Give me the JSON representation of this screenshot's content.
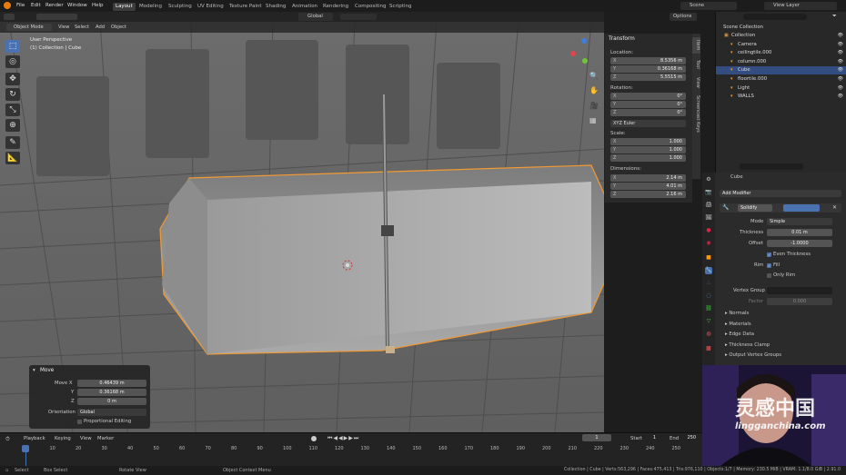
{
  "menu": [
    "File",
    "Edit",
    "Render",
    "Window",
    "Help"
  ],
  "workspaces": [
    "Layout",
    "Modeling",
    "Sculpting",
    "UV Editing",
    "Texture Paint",
    "Shading",
    "Animation",
    "Rendering",
    "Compositing",
    "Scripting"
  ],
  "scene_label": "Scene",
  "view_layer_label": "View Layer",
  "header": {
    "mode": "Object Mode",
    "view": "View",
    "select": "Select",
    "add": "Add",
    "object": "Object",
    "orientation": "Global",
    "options": "Options"
  },
  "viewport": {
    "perspective": "User Perspective",
    "collection_info": "(1) Collection | Cube"
  },
  "transform": {
    "title": "Transform",
    "location_label": "Location:",
    "location": [
      {
        "axis": "X",
        "value": "8.5356 m"
      },
      {
        "axis": "Y",
        "value": "0.36168 m"
      },
      {
        "axis": "Z",
        "value": "5.5515 m"
      }
    ],
    "rotation_label": "Rotation:",
    "rotation": [
      {
        "axis": "X",
        "value": "0°"
      },
      {
        "axis": "Y",
        "value": "0°"
      },
      {
        "axis": "Z",
        "value": "0°"
      }
    ],
    "rotation_mode": "XYZ Euler",
    "scale_label": "Scale:",
    "scale": [
      {
        "axis": "X",
        "value": "1.000"
      },
      {
        "axis": "Y",
        "value": "1.000"
      },
      {
        "axis": "Z",
        "value": "1.000"
      }
    ],
    "dimensions_label": "Dimensions:",
    "dimensions": [
      {
        "axis": "X",
        "value": "2.14 m"
      },
      {
        "axis": "Y",
        "value": "4.01 m"
      },
      {
        "axis": "Z",
        "value": "2.16 m"
      }
    ]
  },
  "ntabs": [
    "Item",
    "Tool",
    "View",
    "Screencast Keys"
  ],
  "outliner": {
    "root": "Scene Collection",
    "items": [
      {
        "label": "Collection",
        "indent": 1
      },
      {
        "label": "Camera",
        "indent": 2
      },
      {
        "label": "ceilingtile.000",
        "indent": 2
      },
      {
        "label": "column.000",
        "indent": 2
      },
      {
        "label": "Cube",
        "indent": 2,
        "selected": true
      },
      {
        "label": "floortile.000",
        "indent": 2
      },
      {
        "label": "Light",
        "indent": 2
      },
      {
        "label": "WALLS",
        "indent": 2
      }
    ]
  },
  "properties": {
    "object_name": "Cube",
    "add_modifier": "Add Modifier",
    "modifier_name": "Solidify",
    "mode_label": "Mode",
    "mode_value": "Simple",
    "thickness_label": "Thickness",
    "thickness_value": "0.01 m",
    "offset_label": "Offset",
    "offset_value": "-1.0000",
    "even_thickness": "Even Thickness",
    "rim_label": "Rim",
    "fill": "Fill",
    "only_rim": "Only Rim",
    "vertex_group_label": "Vertex Group",
    "factor_label": "Factor",
    "factor_value": "0.000",
    "sections": [
      "Normals",
      "Materials",
      "Edge Data",
      "Thickness Clamp",
      "Output Vertex Groups"
    ]
  },
  "redo": {
    "title": "Move",
    "move_x_label": "Move X",
    "move_x": "0.46439 m",
    "y_label": "Y",
    "y": "0.36168 m",
    "z_label": "Z",
    "z": "0 m",
    "orientation_label": "Orientation",
    "orientation": "Global",
    "proportional": "Proportional Editing"
  },
  "timeline": {
    "playback": "Playback",
    "keying": "Keying",
    "view": "View",
    "marker": "Marker",
    "current_frame": "1",
    "start_label": "Start",
    "start": "1",
    "end_label": "End",
    "end": "250",
    "ticks": [
      "1",
      "10",
      "20",
      "30",
      "40",
      "50",
      "60",
      "70",
      "80",
      "90",
      "100",
      "110",
      "120",
      "130",
      "140",
      "150",
      "160",
      "170",
      "180",
      "190",
      "200",
      "210",
      "220",
      "230",
      "240",
      "250"
    ]
  },
  "status": {
    "select": "Select",
    "box_select": "Box Select",
    "rotate_view": "Rotate View",
    "context_menu": "Object Context Menu",
    "stats": "Collection | Cube | Verts:563,296 | Faces:475,413 | Tris:976,110 | Objects:1/7 | Memory: 230.5 MiB | VRAM: 1.1/8.0 GiB | 2.91.0"
  },
  "watermark": {
    "brand": "灵感中国",
    "url": "lingganchina.com"
  },
  "colors": {
    "accent": "#4a72b0",
    "selection_outline": "#f39a32",
    "background": "#1d1d1d",
    "panel": "#2b2b2b"
  }
}
